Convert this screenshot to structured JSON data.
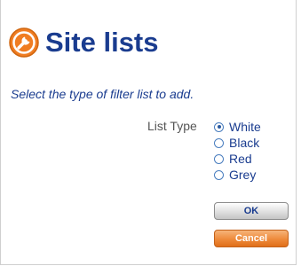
{
  "header": {
    "title": "Site lists",
    "icon": "wrench-icon",
    "icon_color": "#f07d22"
  },
  "form": {
    "instruction": "Select the type of filter list to add.",
    "list_type_label": "List Type",
    "options": [
      {
        "label": "White",
        "checked": true
      },
      {
        "label": "Black",
        "checked": false
      },
      {
        "label": "Red",
        "checked": false
      },
      {
        "label": "Grey",
        "checked": false
      }
    ]
  },
  "buttons": {
    "ok_label": "OK",
    "cancel_label": "Cancel"
  },
  "colors": {
    "title": "#1a3c8f",
    "accent": "#f07d22"
  }
}
